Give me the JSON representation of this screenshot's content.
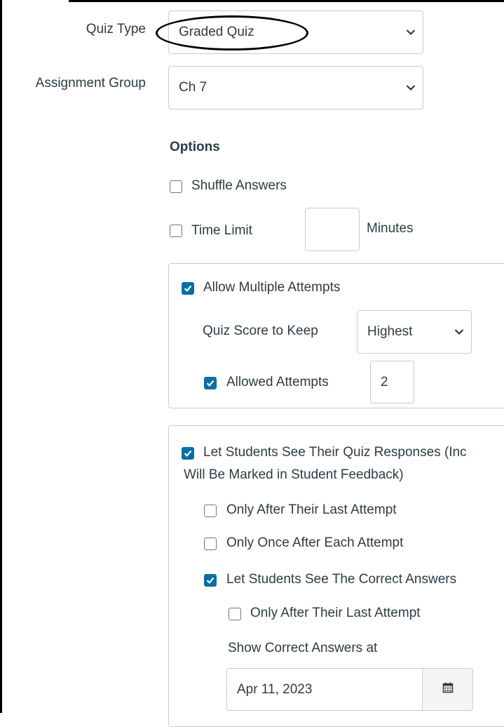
{
  "quiz_type": {
    "label": "Quiz Type",
    "value": "Graded Quiz",
    "icon": "chevron-down-icon"
  },
  "assignment_group": {
    "label": "Assignment Group",
    "value": "Ch 7",
    "icon": "chevron-down-icon"
  },
  "options": {
    "heading": "Options",
    "shuffle_answers": {
      "label": "Shuffle Answers",
      "checked": false
    },
    "time_limit": {
      "label": "Time Limit",
      "checked": false,
      "value": "",
      "unit": "Minutes"
    }
  },
  "attempts": {
    "allow_multiple": {
      "label": "Allow Multiple Attempts",
      "checked": true
    },
    "score_to_keep": {
      "label": "Quiz Score to Keep",
      "value": "Highest",
      "icon": "chevron-down-icon"
    },
    "allowed_attempts": {
      "label": "Allowed Attempts",
      "checked": true,
      "value": "2"
    }
  },
  "responses": {
    "let_see_responses": {
      "label_line1": "Let Students See Their Quiz Responses (Inc",
      "label_line2": "Will Be Marked in Student Feedback)",
      "checked": true
    },
    "only_after_last": {
      "label": "Only After Their Last Attempt",
      "checked": false
    },
    "only_once_after_each": {
      "label": "Only Once After Each Attempt",
      "checked": false
    },
    "see_correct": {
      "label": "Let Students See The Correct Answers",
      "checked": true
    },
    "correct_only_after_last": {
      "label": "Only After Their Last Attempt",
      "checked": false
    },
    "show_correct_at": {
      "label": "Show Correct Answers at",
      "value": "Apr 11, 2023",
      "icon": "calendar-icon"
    }
  },
  "colors": {
    "accent": "#0770a3",
    "border": "#c7cdd1",
    "text": "#2d3b45",
    "annotation": "#000000"
  }
}
